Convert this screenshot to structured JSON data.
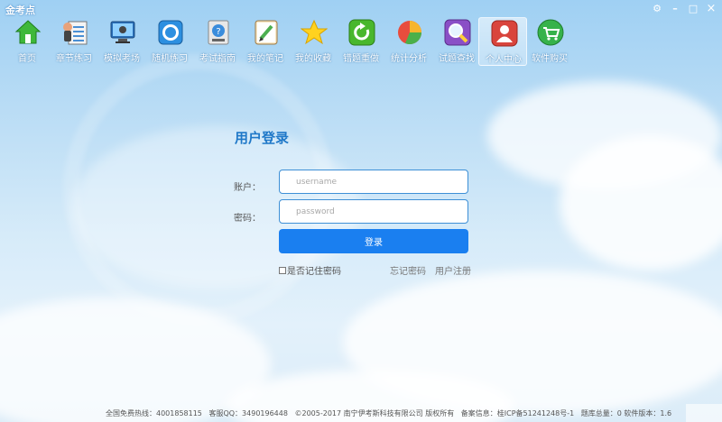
{
  "window": {
    "title": "金考点"
  },
  "window_controls": {
    "settings_icon": "gear-icon",
    "minimize_icon": "minimize-icon",
    "maximize_icon": "maximize-icon",
    "close_icon": "close-icon"
  },
  "toolbar": {
    "items": [
      {
        "label": "首页",
        "icon": "home-icon"
      },
      {
        "label": "章节练习",
        "icon": "document-list-icon"
      },
      {
        "label": "模拟考场",
        "icon": "monitor-icon"
      },
      {
        "label": "随机练习",
        "icon": "circle-screen-icon"
      },
      {
        "label": "考试指南",
        "icon": "guide-book-icon"
      },
      {
        "label": "我的笔记",
        "icon": "pencil-note-icon"
      },
      {
        "label": "我的收藏",
        "icon": "star-icon"
      },
      {
        "label": "错题重做",
        "icon": "redo-icon"
      },
      {
        "label": "统计分析",
        "icon": "pie-chart-icon"
      },
      {
        "label": "试题查找",
        "icon": "search-icon"
      },
      {
        "label": "个人中心",
        "icon": "user-icon"
      },
      {
        "label": "软件购买",
        "icon": "cart-icon"
      }
    ],
    "active_index": 10
  },
  "login": {
    "title": "用户登录",
    "account_label": "账户：",
    "password_label": "密码：",
    "username_placeholder": "username",
    "password_placeholder": "password",
    "submit_label": "登录",
    "remember_label": "是否记住密码",
    "forgot_label": "忘记密码",
    "register_label": "用户注册"
  },
  "footer": {
    "hotline": "全国免费热线：4001858115",
    "qq": "客服QQ：3490196448",
    "copyright": "©2005-2017  南宁伊考斯科技有限公司 版权所有",
    "icp": "备案信息：桂ICP备51241248号-1",
    "total": "题库总量：0 软件版本：1.6"
  },
  "colors": {
    "accent": "#1a7ff0",
    "title": "#1f78c8",
    "input_border": "#3d8fd6"
  }
}
